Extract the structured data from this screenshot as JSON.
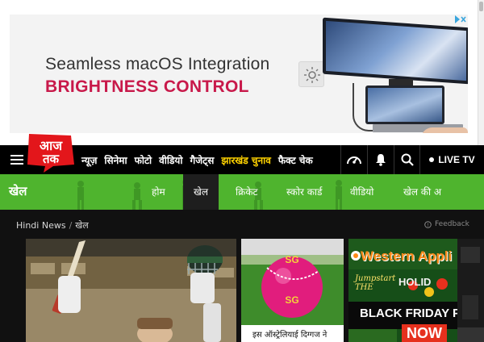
{
  "ad": {
    "line1": "Seamless macOS Integration",
    "line2": "BRIGHTNESS CONTROL",
    "accent_color": "#c8194a",
    "close_icon": "adchoices-close-icon"
  },
  "header": {
    "logo_text": "आज तक",
    "nav": [
      "न्यूज़",
      "सिनेमा",
      "फोटो",
      "वीडियो",
      "गैजेट्स",
      "झारखंड चुनाव",
      "फैक्ट चेक"
    ],
    "highlight_color": "#ffd200",
    "icons": [
      "speedometer-icon",
      "bell-icon",
      "search-icon"
    ],
    "live_label": "LIVE TV"
  },
  "section": {
    "title": "खेल",
    "tabs": [
      "होम",
      "खेल",
      "क्रिकेट",
      "स्कोर कार्ड",
      "वीडियो",
      "खेल की अ"
    ],
    "active_tab": "खेल",
    "color": "#4fb42e"
  },
  "breadcrumb": {
    "home": "Hindi News",
    "current": "खेल"
  },
  "feedback": {
    "label": "Feedback"
  },
  "cards": {
    "ball_caption": "इस ऑस्ट्रेलियाई दिग्गज ने",
    "side_ad": {
      "title": "Western Appli",
      "jumpstart": "Jumpstart",
      "the": "THE",
      "holiday": "HOLID",
      "black_friday": "BLACK FRIDAY PR",
      "now": "NOW"
    }
  }
}
